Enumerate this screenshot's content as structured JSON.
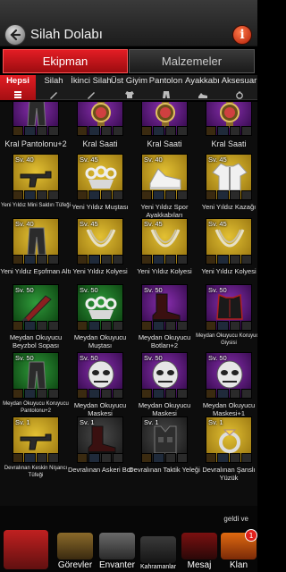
{
  "header": {
    "title": "Silah Dolabı"
  },
  "tabs": {
    "main": "Ekipman",
    "materials": "Malzemeler"
  },
  "categories": [
    {
      "label": "Hepsi",
      "icon": "stack-icon"
    },
    {
      "label": "Silah",
      "icon": "knife-icon"
    },
    {
      "label": "İkinci Silah",
      "icon": "knife-icon"
    },
    {
      "label": "Üst Giyim",
      "icon": "jacket-icon"
    },
    {
      "label": "Pantolon",
      "icon": "pants-icon"
    },
    {
      "label": "Ayakkabı",
      "icon": "shoe-icon"
    },
    {
      "label": "Aksesuar",
      "icon": "ring-icon"
    }
  ],
  "items": [
    {
      "level": "",
      "name": "Kral Pantolonu+2",
      "color": "purple",
      "icon": "pants"
    },
    {
      "level": "",
      "name": "Kral Saati",
      "color": "purple",
      "icon": "watch"
    },
    {
      "level": "",
      "name": "Kral Saati",
      "color": "purple",
      "icon": "watch"
    },
    {
      "level": "",
      "name": "Kral Saati",
      "color": "purple",
      "icon": "watch"
    },
    {
      "level": "Sv. 40",
      "name": "Yeni Yıldız Mini Saldırı Tüfeği",
      "color": "yellow",
      "icon": "gun"
    },
    {
      "level": "Sv. 45",
      "name": "Yeni Yıldız Muştası",
      "color": "yellow",
      "icon": "knuckles"
    },
    {
      "level": "Sv. 40",
      "name": "Yeni Yıldız Spor Ayakkabıları",
      "color": "yellow",
      "icon": "shoe"
    },
    {
      "level": "Sv. 45",
      "name": "Yeni Yıldız Kazağı",
      "color": "yellow",
      "icon": "jacket"
    },
    {
      "level": "Sv. 40",
      "name": "Yeni Yıldız Eşofman Altı",
      "color": "yellow",
      "icon": "pants"
    },
    {
      "level": "Sv. 45",
      "name": "Yeni Yıldız Kolyesi",
      "color": "yellow",
      "icon": "necklace"
    },
    {
      "level": "Sv. 45",
      "name": "Yeni Yıldız Kolyesi",
      "color": "yellow",
      "icon": "necklace"
    },
    {
      "level": "Sv. 45",
      "name": "Yeni Yıldız Kolyesi",
      "color": "yellow",
      "icon": "necklace"
    },
    {
      "level": "Sv. 50",
      "name": "Meydan Okuyucu Beyzbol Sopası",
      "color": "green",
      "icon": "bat"
    },
    {
      "level": "Sv. 50",
      "name": "Meydan Okuyucu Muştası",
      "color": "green",
      "icon": "knuckles"
    },
    {
      "level": "Sv. 50",
      "name": "Meydan Okuyucu Botları+2",
      "color": "purple",
      "icon": "boot"
    },
    {
      "level": "Sv. 50",
      "name": "Meydan Okuyucu Koruyucu Giysisi",
      "color": "purple",
      "icon": "armor"
    },
    {
      "level": "Sv. 50",
      "name": "Meydan Okuyucu Koruyucu Pantolonu+2",
      "color": "green",
      "icon": "pants"
    },
    {
      "level": "Sv. 50",
      "name": "Meydan Okuyucu Maskesi",
      "color": "purple",
      "icon": "mask"
    },
    {
      "level": "Sv. 50",
      "name": "Meydan Okuyucu Maskesi",
      "color": "purple",
      "icon": "mask"
    },
    {
      "level": "Sv. 50",
      "name": "Meydan Okuyucu Maskesi+1",
      "color": "purple",
      "icon": "mask"
    },
    {
      "level": "Sv. 1",
      "name": "Devralınan Keskin Nişancı Tüfeği",
      "color": "yellow",
      "icon": "gun"
    },
    {
      "level": "Sv. 1",
      "name": "Devralınan Askeri Bot",
      "color": "gray",
      "icon": "boot"
    },
    {
      "level": "Sv. 1",
      "name": "Devralınan Taktik Yeleği",
      "color": "gray",
      "icon": "vest"
    },
    {
      "level": "Sv. 1",
      "name": "Devralınan Şanslı Yüzük",
      "color": "yellow",
      "icon": "ring"
    }
  ],
  "bottom_nav": {
    "notification": "geldi ve",
    "items": [
      {
        "label": "Görevler"
      },
      {
        "label": "Envanter"
      },
      {
        "label": "Kahramanlar"
      },
      {
        "label": "Mesaj"
      },
      {
        "label": "Klan",
        "badge": "1"
      }
    ]
  }
}
